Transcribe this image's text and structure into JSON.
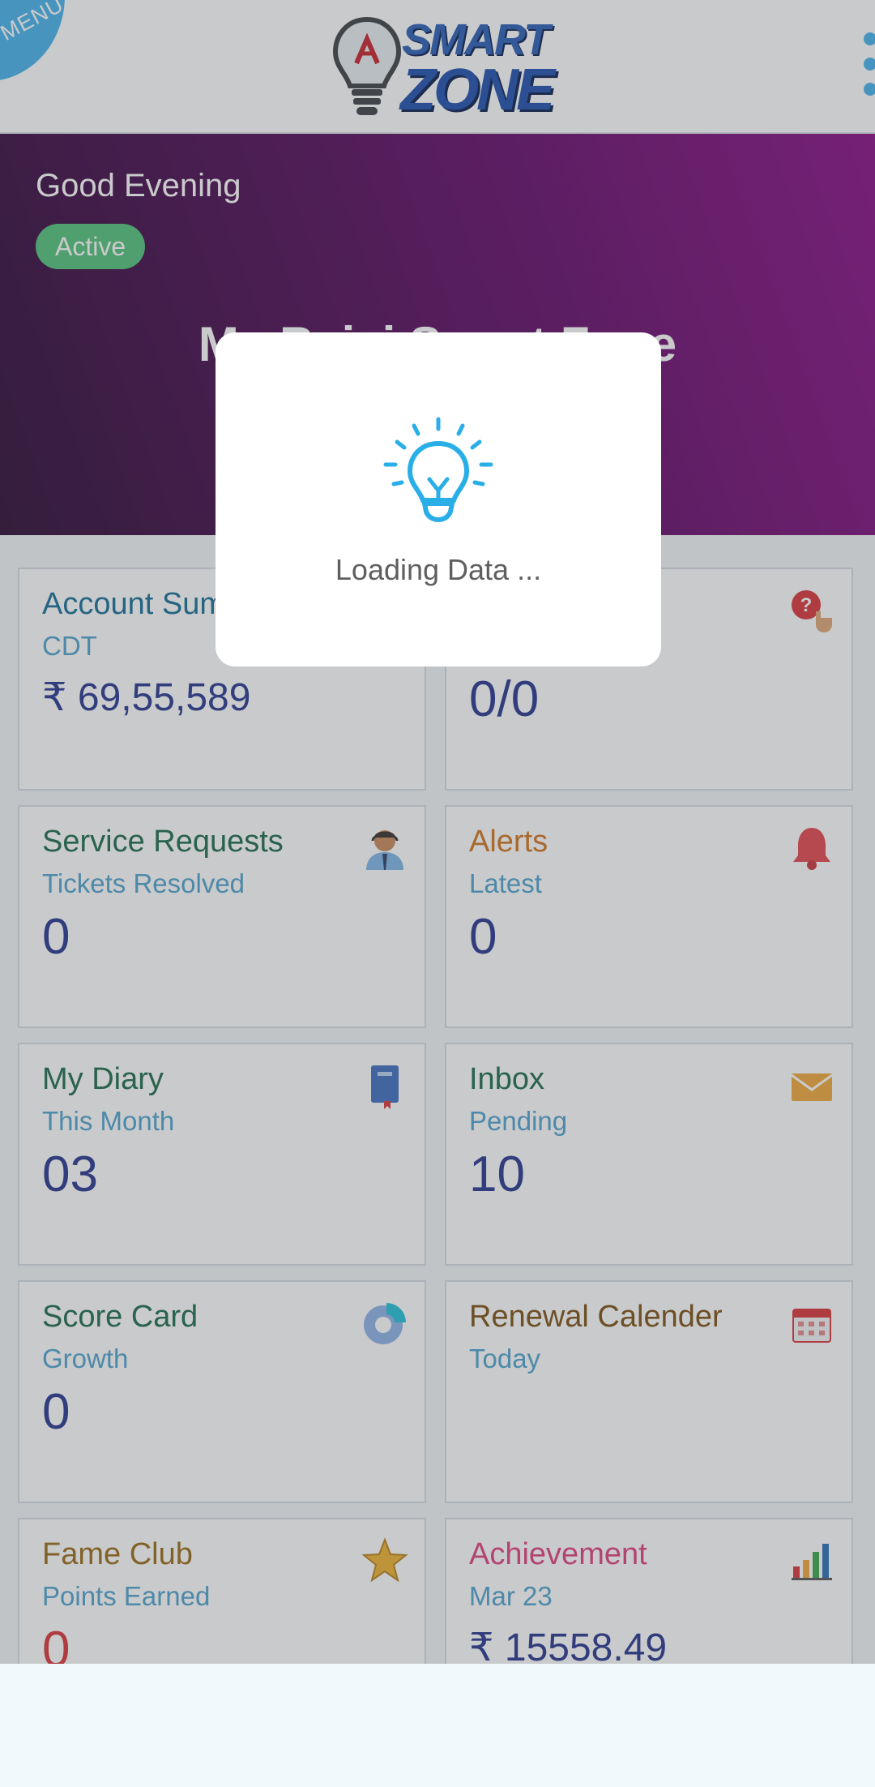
{
  "header": {
    "menu_label": "MENU",
    "logo_line1": "SMART",
    "logo_line2": "ZONE",
    "menu_icon": "kebab-menu-icon"
  },
  "hero": {
    "greeting": "Good Evening",
    "status": "Active",
    "title": "My Bajaj Smart Zone"
  },
  "colors": {
    "hero_start": "#2a0a33",
    "hero_end": "#880c86",
    "accent_blue": "#45b4ec",
    "value_blue": "#26368f",
    "status_green": "#52c27a"
  },
  "cards": [
    {
      "title": "Account Summary",
      "subtitle": "CDT",
      "value": "₹ 69,55,589",
      "icon": "account-icon",
      "title_color": "#156f98"
    },
    {
      "title": "",
      "subtitle": "",
      "value": "0/0",
      "icon": "help-hand-icon",
      "title_color": "#156f98"
    },
    {
      "title": "Service Requests",
      "subtitle": "Tickets Resolved",
      "value": "0",
      "icon": "support-agent-icon",
      "title_color": "#1b6a4b"
    },
    {
      "title": "Alerts",
      "subtitle": "Latest",
      "value": "0",
      "icon": "bell-icon",
      "title_color": "#d2741c"
    },
    {
      "title": "My Diary",
      "subtitle": "This Month",
      "value": "03",
      "icon": "diary-icon",
      "title_color": "#1b6a4b"
    },
    {
      "title": "Inbox",
      "subtitle": "Pending",
      "value": "10",
      "icon": "envelope-icon",
      "title_color": "#1b6a4b"
    },
    {
      "title": "Score Card",
      "subtitle": "Growth",
      "value": "0",
      "icon": "pie-chart-icon",
      "title_color": "#1b6a4b"
    },
    {
      "title": "Renewal Calender",
      "subtitle": "Today",
      "value": "",
      "icon": "calendar-icon",
      "title_color": "#7b4f14"
    },
    {
      "title": "Fame Club",
      "subtitle": "Points Earned",
      "value": "0",
      "icon": "star-icon",
      "title_color": "#9a6b16"
    },
    {
      "title": "Achievement",
      "subtitle": "Mar 23",
      "value": "₹ 15558.49",
      "icon": "bar-chart-icon",
      "title_color": "#e0407e"
    }
  ],
  "dialog": {
    "text": "Loading Data ...",
    "icon": "lightbulb-icon"
  }
}
